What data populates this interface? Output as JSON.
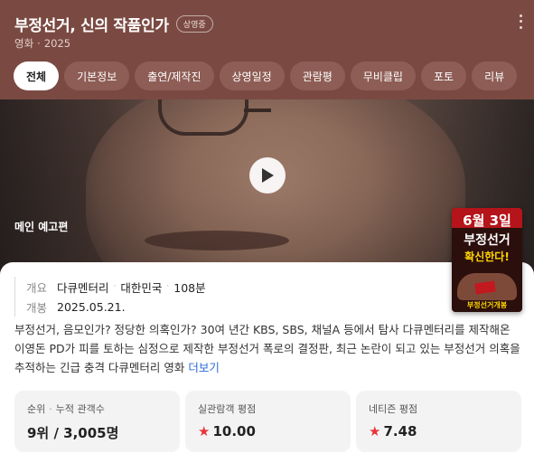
{
  "header": {
    "title": "부정선거, 신의 작품인가",
    "badge": "상영중",
    "category": "영화",
    "year": "2025"
  },
  "tabs": [
    {
      "label": "전체",
      "active": true
    },
    {
      "label": "기본정보",
      "active": false
    },
    {
      "label": "출연/제작진",
      "active": false
    },
    {
      "label": "상영일정",
      "active": false
    },
    {
      "label": "관람평",
      "active": false
    },
    {
      "label": "무비클립",
      "active": false
    },
    {
      "label": "포토",
      "active": false
    },
    {
      "label": "리뷰",
      "active": false
    }
  ],
  "hero": {
    "label": "메인 예고편"
  },
  "poster": {
    "line1": "6월 3일",
    "line2": "부정선거",
    "line3": "확신한다!",
    "footer": "부정선거개봉"
  },
  "info": {
    "overview_key": "개요",
    "genre": "다큐멘터리",
    "country": "대한민국",
    "runtime": "108분",
    "release_key": "개봉",
    "release_date": "2025.05.21."
  },
  "description": {
    "text": "부정선거, 음모인가? 정당한 의혹인가? 30여 년간 KBS, SBS, 채널A 등에서 탐사 다큐멘터리를 제작해온 이영돈 PD가 피를 토하는 심정으로 제작한 부정선거 폭로의 결정판, 최근 논란이 되고 있는 부정선거 의혹을 추적하는 긴급 충격 다큐멘터리 영화",
    "more_link": "더보기"
  },
  "stats": {
    "rank_label": "순위",
    "audience_label": "누적 관객수",
    "rank_value": "9위 / 3,005명",
    "audience_rating_label": "실관람객 평점",
    "audience_rating": "10.00",
    "netizen_rating_label": "네티즌 평점",
    "netizen_rating": "7.48"
  },
  "colors": {
    "header_bg": "#7a4a42",
    "star": "#e8343a",
    "link": "#2a6ad9"
  }
}
